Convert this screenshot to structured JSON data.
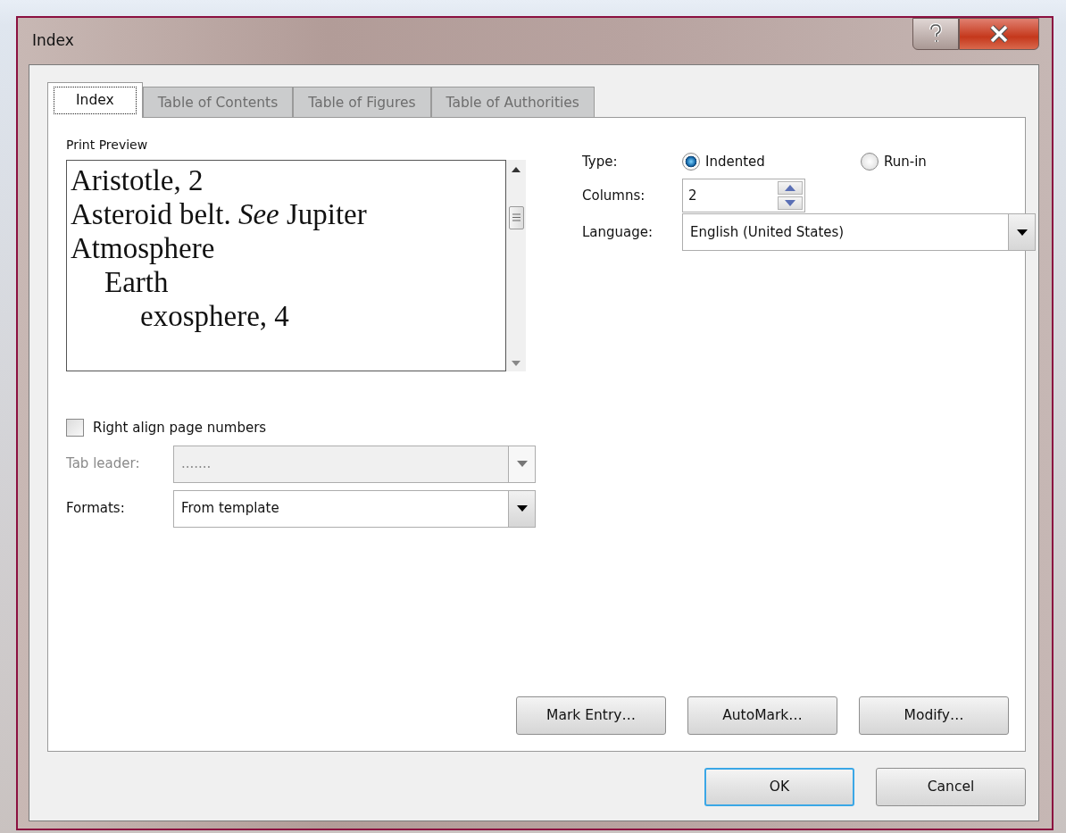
{
  "window": {
    "title": "Index"
  },
  "tabs": [
    {
      "label": "Index",
      "selected": true
    },
    {
      "label": "Table of Contents",
      "selected": false
    },
    {
      "label": "Table of Figures",
      "selected": false
    },
    {
      "label": "Table of Authorities",
      "selected": false
    }
  ],
  "preview": {
    "label": "Print Preview",
    "entries": [
      {
        "text": "Aristotle, 2"
      },
      {
        "text": "Asteroid belt. *See* Jupiter"
      },
      {
        "text": "Atmosphere",
        "children": [
          {
            "text": "Earth",
            "children": [
              {
                "text": "exosphere, 4"
              }
            ]
          }
        ]
      }
    ]
  },
  "right_align": {
    "label": "Right align page numbers",
    "checked": false
  },
  "tab_leader": {
    "label": "Tab leader:",
    "value": ".......",
    "disabled": true
  },
  "formats": {
    "label": "Formats:",
    "value": "From template",
    "disabled": false
  },
  "type": {
    "label": "Type:",
    "options": [
      {
        "label": "Indented",
        "selected": true
      },
      {
        "label": "Run-in",
        "selected": false
      }
    ]
  },
  "columns": {
    "label": "Columns:",
    "value": "2"
  },
  "language": {
    "label": "Language:",
    "value": "English (United States)"
  },
  "action_buttons": [
    "Mark Entry…",
    "AutoMark…",
    "Modify…"
  ],
  "dialog_buttons": [
    {
      "label": "OK",
      "default": true
    },
    {
      "label": "Cancel",
      "default": false
    }
  ]
}
